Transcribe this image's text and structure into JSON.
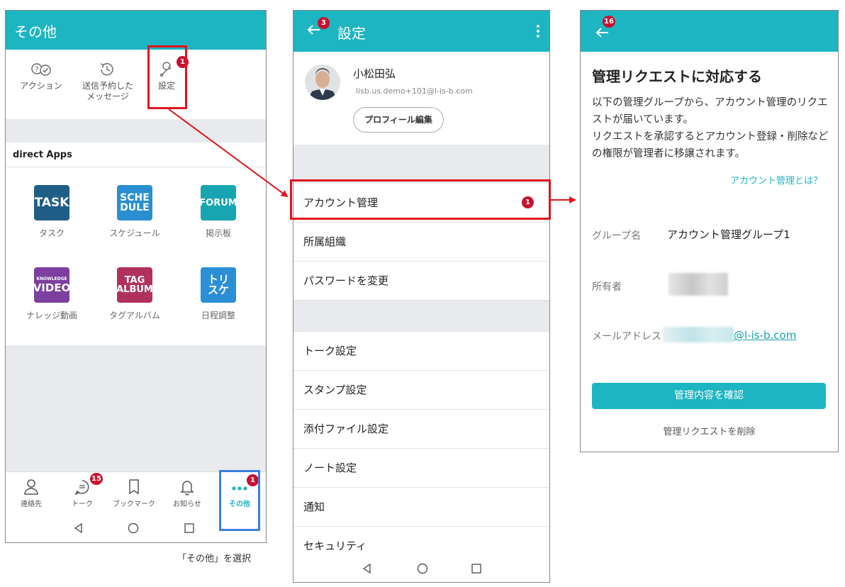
{
  "screen1": {
    "title": "その他",
    "actions": [
      {
        "label": "アクション",
        "icon": "action-icon"
      },
      {
        "label": "送信予約した\nメッセージ",
        "icon": "scheduled-clock-icon"
      },
      {
        "label": "設定",
        "icon": "wrench-icon",
        "badge": "1"
      }
    ],
    "section_title": "direct Apps",
    "apps": [
      {
        "label": "タスク",
        "icon_text": "TASK",
        "color": "#1f5e87"
      },
      {
        "label": "スケジュール",
        "icon_text": "SCHE\nDULE",
        "color": "#2a8fd0"
      },
      {
        "label": "掲示板",
        "icon_text": "FORUM",
        "color": "#17a6b0"
      },
      {
        "label": "ナレッジ動画",
        "icon_text_small": "KNOWLEDGE",
        "icon_text": "VIDEO",
        "color": "#7d3fa0"
      },
      {
        "label": "タグアルバム",
        "icon_text": "TAG\nALBUM",
        "color": "#b0325c"
      },
      {
        "label": "日程調整",
        "icon_text": "トリ\nスケ",
        "color": "#2b8fd6"
      }
    ],
    "nav": [
      {
        "label": "連絡先",
        "icon": "person-icon"
      },
      {
        "label": "トーク",
        "icon": "chat-icon",
        "badge": "15"
      },
      {
        "label": "ブックマーク",
        "icon": "bookmark-icon"
      },
      {
        "label": "お知らせ",
        "icon": "bell-icon"
      },
      {
        "label": "その他",
        "icon": "more-dots-icon",
        "badge": "1"
      }
    ],
    "caption": "「その他」を選択"
  },
  "screen2": {
    "title": "設定",
    "back_badge": "3",
    "profile": {
      "name": "小松田弘",
      "email": "lisb.us.demo+101@l-is-b.com",
      "edit_button": "プロフィール編集"
    },
    "group1": [
      "アカウント管理",
      "所属組織",
      "パスワードを変更"
    ],
    "account_badge": "1",
    "group2": [
      "トーク設定",
      "スタンプ設定",
      "添付ファイル設定",
      "ノート設定",
      "通知",
      "セキュリティ"
    ]
  },
  "screen3": {
    "back_badge": "16",
    "title": "管理リクエストに対応する",
    "description": "以下の管理グループから、アカウント管理のリクエストが届いています。\nリクエストを承認するとアカウント登録・削除などの権限が管理者に移譲されます。",
    "help_link": "アカウント管理とは？",
    "group_label": "グループ名",
    "group_value": "アカウント管理グループ1",
    "owner_label": "所有者",
    "email_label": "メールアドレス",
    "email_suffix": "@l-is-b.com",
    "confirm_button": "管理内容を確認",
    "delete_link": "管理リクエストを削除"
  },
  "colors": {
    "teal": "#1db5c1",
    "badge": "#c8102e",
    "annotation_red": "#e0141e",
    "annotation_blue": "#3c7fe0"
  }
}
